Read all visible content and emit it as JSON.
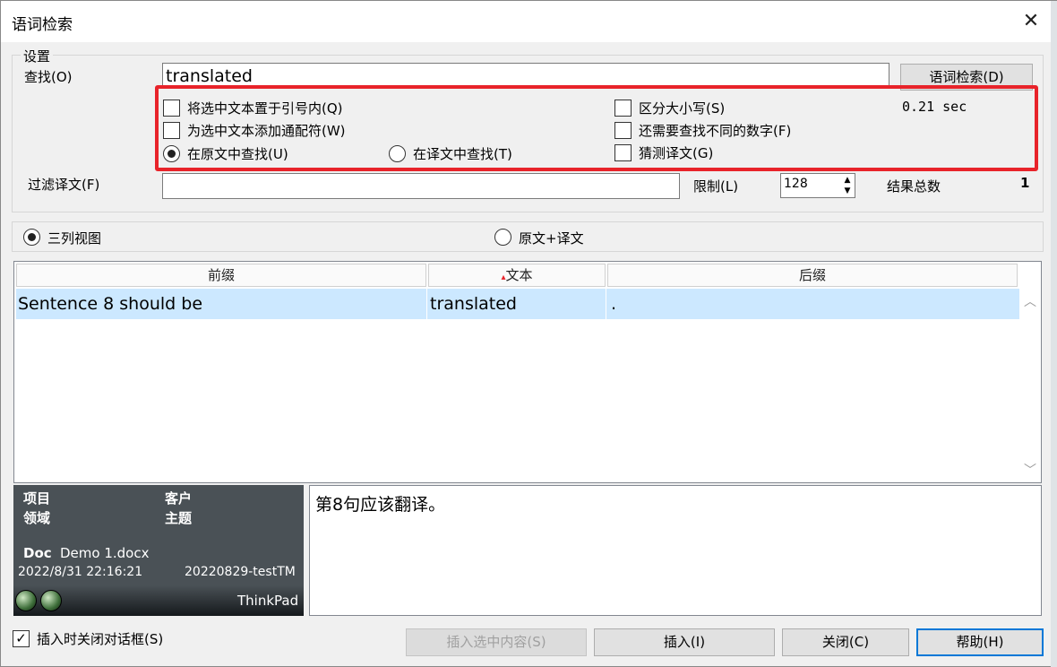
{
  "window": {
    "title": "语词检索",
    "close_glyph": "✕"
  },
  "settings": {
    "group_label": "设置",
    "find_label": "查找(O)",
    "find_value": "translated",
    "search_button": "语词检索(D)",
    "time_text": "0.21 sec",
    "options": {
      "quote_selected": {
        "label": "将选中文本置于引号内(Q)",
        "checked": false
      },
      "add_wildcard": {
        "label": "为选中文本添加通配符(W)",
        "checked": false
      },
      "search_source": {
        "label": "在原文中查找(U)",
        "selected": true
      },
      "search_target": {
        "label": "在译文中查找(T)",
        "selected": false
      },
      "case_sensitive": {
        "label": "区分大小写(S)",
        "checked": false
      },
      "different_numbers": {
        "label": "还需要查找不同的数字(F)",
        "checked": false
      },
      "guess_translation": {
        "label": "猜测译文(G)",
        "checked": false
      }
    },
    "filter_label": "过滤译文(F)",
    "filter_value": "",
    "limit_label": "限制(L)",
    "limit_value": "128",
    "total_label": "结果总数",
    "total_value": "1"
  },
  "view": {
    "three_column": {
      "label": "三列视图",
      "selected": true
    },
    "source_target": {
      "label": "原文+译文",
      "selected": false
    }
  },
  "results": {
    "columns": [
      "前缀",
      "文本",
      "后缀"
    ],
    "sort_indicator": "▴",
    "rows": [
      {
        "prefix": "Sentence 8 should be",
        "text": "translated",
        "suffix": "."
      }
    ]
  },
  "info": {
    "project_label": "项目",
    "client_label": "客户",
    "domain_label": "领域",
    "subject_label": "主题",
    "doc_label": "Doc",
    "doc_name": "Demo 1.docx",
    "datetime": "2022/8/31 22:16:21",
    "tm_name": "20220829-testTM",
    "user": "ThinkPad"
  },
  "preview": {
    "text": "第8句应该翻译。"
  },
  "footer": {
    "close_on_insert": {
      "label": "插入时关闭对话框(S)",
      "checked": true
    },
    "insert_selected": "插入选中内容(S)",
    "insert": "插入(I)",
    "close": "关闭(C)",
    "help": "帮助(H)"
  },
  "colors": {
    "highlight": "#e8232a",
    "selection": "#cce8ff",
    "default_button_border": "#0078d7",
    "info_panel": "#4a5156"
  }
}
